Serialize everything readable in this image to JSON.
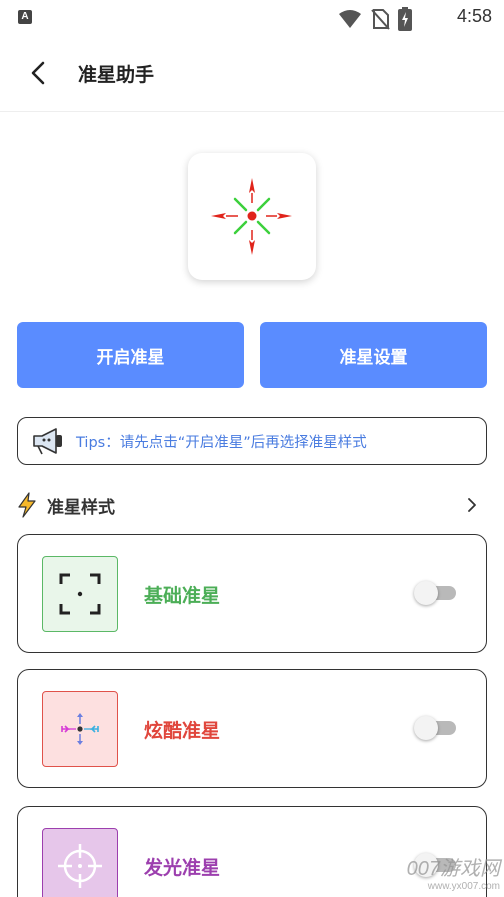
{
  "status_bar": {
    "app_icon_letter": "A",
    "time": "4:58",
    "icons": [
      "wifi-icon",
      "no-sim-icon",
      "battery-charging-icon"
    ]
  },
  "header": {
    "title": "准星助手",
    "back_icon": "chevron-left-icon"
  },
  "actions": {
    "start_label": "开启准星",
    "settings_label": "准星设置",
    "accent_color": "#5a8cff"
  },
  "tips": {
    "text": "Tips：请先点击“开启准星”后再选择准星样式",
    "icon": "megaphone-icon"
  },
  "section": {
    "title": "准星样式",
    "icon": "lightning-icon",
    "more_icon": "chevron-right-icon"
  },
  "styles": [
    {
      "label": "基础准星",
      "color": "#4cae57",
      "enabled": false,
      "icon": "basic-crosshair-icon"
    },
    {
      "label": "炫酷准星",
      "color": "#e0463c",
      "enabled": false,
      "icon": "cool-crosshair-icon"
    },
    {
      "label": "发光准星",
      "color": "#9c3fae",
      "enabled": false,
      "icon": "glow-crosshair-icon"
    }
  ],
  "watermark": {
    "main": "007游戏网",
    "sub": "www.yx007.com"
  }
}
